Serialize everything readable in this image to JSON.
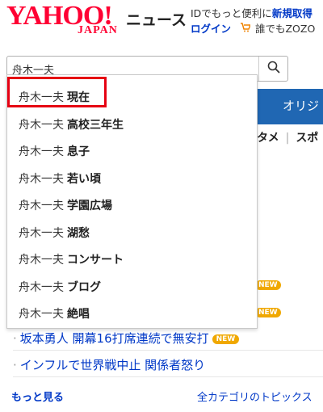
{
  "header": {
    "logo_main": "YAHOO!",
    "logo_sub": "JAPAN",
    "service_name": "ニュース",
    "id_message_prefix": "IDでもっと便利に",
    "id_message_strong": "新規取得",
    "login_label": "ログイン",
    "zozo_text": "誰でもZOZO"
  },
  "search": {
    "value": "舟木一夫",
    "button_icon": "magnifier-icon"
  },
  "suggestions": [
    {
      "base": "舟木一夫",
      "suffix": "現在"
    },
    {
      "base": "舟木一夫",
      "suffix": "高校三年生"
    },
    {
      "base": "舟木一夫",
      "suffix": "息子"
    },
    {
      "base": "舟木一夫",
      "suffix": "若い頃"
    },
    {
      "base": "舟木一夫",
      "suffix": "学園広場"
    },
    {
      "base": "舟木一夫",
      "suffix": "湖愁"
    },
    {
      "base": "舟木一夫",
      "suffix": "コンサート"
    },
    {
      "base": "舟木一夫",
      "suffix": "ブログ"
    },
    {
      "base": "舟木一夫",
      "suffix": "絶唱"
    }
  ],
  "background": {
    "nav_tab": "オリジ",
    "subnav_1": "タメ",
    "subnav_2": "スポ",
    "new_badge": "NEW",
    "news": [
      "坂本勇人 開幕16打席連続で無安打",
      "インフルで世界戦中止 関係者怒り"
    ],
    "more_link": "もっと見る",
    "all_categories": "全カテゴリのトピックス"
  },
  "colors": {
    "brand_red": "#ff0033",
    "link_blue": "#0038c7",
    "nav_blue": "#2067b3",
    "highlight_red": "#e60012",
    "badge_orange": "#f0a800"
  }
}
